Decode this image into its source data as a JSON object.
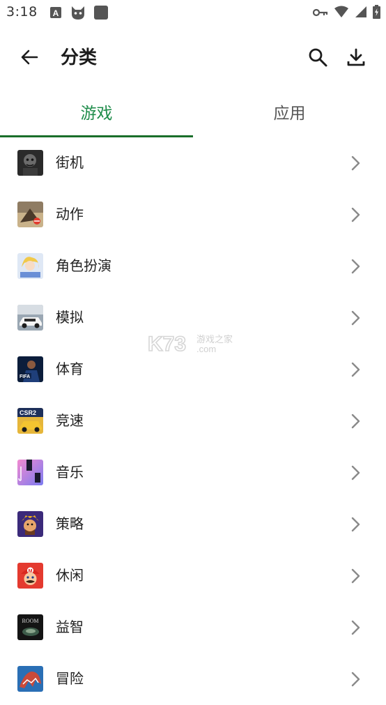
{
  "status_bar": {
    "time": "3:18",
    "left_icons": [
      "a-icon",
      "cat-icon",
      "square-icon"
    ],
    "right_icons": [
      "key-icon",
      "wifi-icon",
      "signal-icon",
      "battery-icon"
    ]
  },
  "app_bar": {
    "title": "分类"
  },
  "tabs": [
    {
      "label": "游戏",
      "active": true
    },
    {
      "label": "应用",
      "active": false
    }
  ],
  "colors": {
    "accent": "#1e8c4a",
    "indicator": "#1a6e2a"
  },
  "categories": [
    {
      "label": "街机",
      "thumb": "arcade-thumb"
    },
    {
      "label": "动作",
      "thumb": "action-thumb"
    },
    {
      "label": "角色扮演",
      "thumb": "rpg-thumb"
    },
    {
      "label": "模拟",
      "thumb": "simulation-thumb"
    },
    {
      "label": "体育",
      "thumb": "sports-thumb"
    },
    {
      "label": "竞速",
      "thumb": "racing-thumb"
    },
    {
      "label": "音乐",
      "thumb": "music-thumb"
    },
    {
      "label": "策略",
      "thumb": "strategy-thumb"
    },
    {
      "label": "休闲",
      "thumb": "casual-thumb"
    },
    {
      "label": "益智",
      "thumb": "puzzle-thumb"
    },
    {
      "label": "冒险",
      "thumb": "adventure-thumb"
    }
  ],
  "watermark": {
    "brand": "K73",
    "text": "游戏之家",
    "domain": ".com"
  }
}
